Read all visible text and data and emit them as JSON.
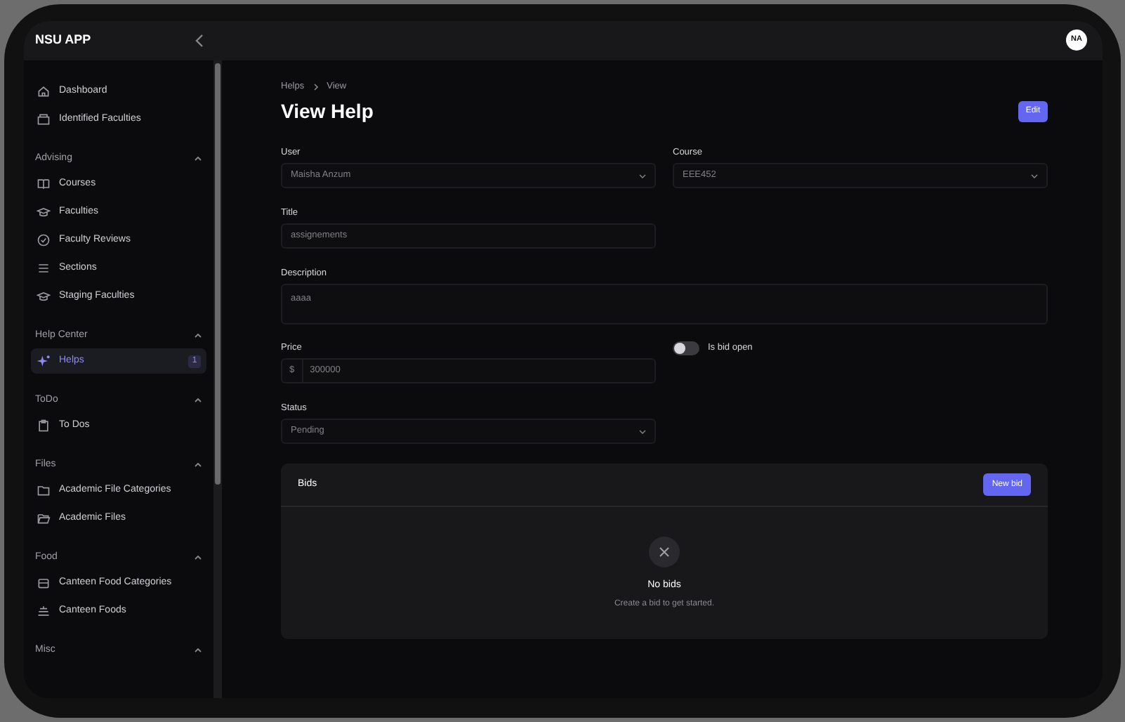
{
  "app": {
    "title": "NSU APP",
    "avatar": "NA"
  },
  "sidebar": {
    "items": [
      {
        "label": "Dashboard",
        "selected": false
      },
      {
        "label": "Identified Faculties",
        "selected": false
      }
    ],
    "groups": [
      {
        "label": "Advising",
        "expanded": true,
        "items": [
          {
            "label": "Courses",
            "selected": false
          },
          {
            "label": "Faculties",
            "selected": false
          },
          {
            "label": "Faculty Reviews",
            "selected": false
          },
          {
            "label": "Sections",
            "selected": false
          },
          {
            "label": "Staging Faculties",
            "selected": false
          }
        ]
      },
      {
        "label": "Help Center",
        "expanded": true,
        "items": [
          {
            "label": "Helps",
            "selected": true,
            "badge": "1"
          }
        ]
      },
      {
        "label": "ToDo",
        "expanded": true,
        "items": [
          {
            "label": "To Dos",
            "selected": false
          }
        ]
      },
      {
        "label": "Files",
        "expanded": true,
        "items": [
          {
            "label": "Academic File Categories",
            "selected": false
          },
          {
            "label": "Academic Files",
            "selected": false
          }
        ]
      },
      {
        "label": "Food",
        "expanded": true,
        "items": [
          {
            "label": "Canteen Food Categories",
            "selected": false
          },
          {
            "label": "Canteen Foods",
            "selected": false
          }
        ]
      },
      {
        "label": "Misc",
        "expanded": true
      }
    ]
  },
  "breadcrumb": [
    "Helps",
    "View"
  ],
  "page_title": "View Help",
  "edit_button": "Edit",
  "form": {
    "user": {
      "label": "User",
      "value": "Maisha Anzum"
    },
    "course": {
      "label": "Course",
      "value": "EEE452"
    },
    "title": {
      "label": "Title",
      "value": "assignements"
    },
    "description": {
      "label": "Description",
      "value": "aaaa"
    },
    "price": {
      "label": "Price",
      "prefix": "$",
      "value": "300000"
    },
    "is_bid_open": {
      "label": "Is bid open",
      "on": false
    },
    "status": {
      "label": "Status",
      "value": "Pending"
    }
  },
  "bids": {
    "title": "Bids",
    "new_button": "New bid",
    "empty_title": "No bids",
    "empty_text": "Create a bid to get started."
  }
}
